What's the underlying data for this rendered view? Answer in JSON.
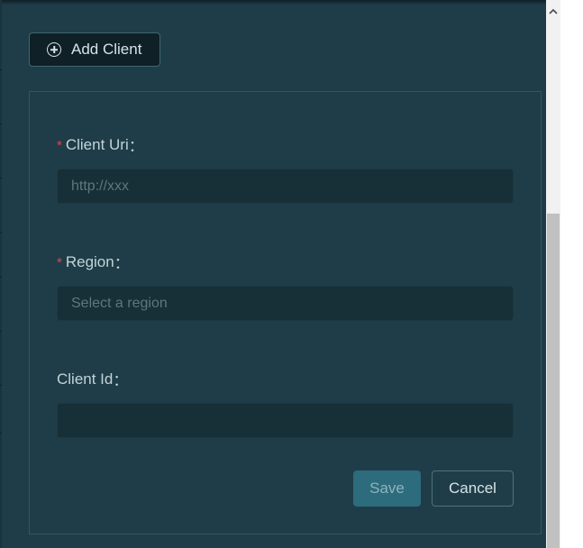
{
  "toolbar": {
    "add_client_label": "Add Client",
    "add_client_icon": "plus-circle-icon"
  },
  "form": {
    "client_uri": {
      "label": "Client Uri",
      "required": true,
      "placeholder": "http://xxx",
      "value": ""
    },
    "region": {
      "label": "Region",
      "required": true,
      "placeholder": "Select a region",
      "value": ""
    },
    "client_id": {
      "label": "Client Id",
      "required": false,
      "placeholder": "",
      "value": ""
    },
    "required_mark": "*",
    "label_suffix": "："
  },
  "actions": {
    "save_label": "Save",
    "cancel_label": "Cancel"
  },
  "colors": {
    "background": "#1f3d48",
    "input_background": "#172f37",
    "primary_button": "#2c6c7c",
    "required_star": "#e0444e"
  },
  "scrollbar": {
    "up_icon": "chevron-up-icon"
  }
}
